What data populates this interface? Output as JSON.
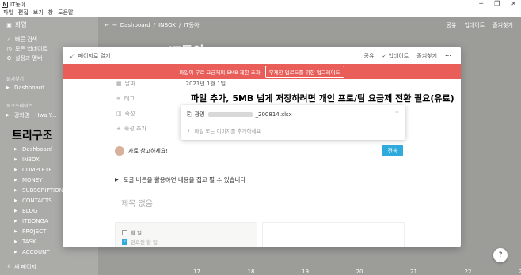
{
  "window": {
    "app_title": "IT동아",
    "menus": [
      "파일",
      "편집",
      "보기",
      "창",
      "도움말"
    ],
    "min_icon": "─",
    "max_icon": "❐",
    "close_icon": "✕"
  },
  "sidebar": {
    "workspace": "화영",
    "quick_items": [
      {
        "icon": "search-icon",
        "glyph": "⌕",
        "label": "빠른 검색"
      },
      {
        "icon": "clock-icon",
        "glyph": "◷",
        "label": "모든 업데이트"
      },
      {
        "icon": "gear-icon",
        "glyph": "⚙",
        "label": "설정과 멤버"
      }
    ],
    "favorites_header": "즐겨찾기",
    "favorites": [
      {
        "label": "Dashboard"
      }
    ],
    "workspace_header": "워크스페이스",
    "workspace_item": "강화영 - Hwa Y...",
    "overlay_title": "트리구조",
    "tree": [
      {
        "label": "Dashboard"
      },
      {
        "label": "INBOX"
      },
      {
        "label": "COMPLETE"
      },
      {
        "label": "MONEY"
      },
      {
        "label": "SUBSCRIPTION"
      },
      {
        "label": "CONTACTS"
      },
      {
        "label": "BLOG"
      },
      {
        "label": "ITDONGA"
      },
      {
        "label": "PROJECT"
      },
      {
        "label": "TASK"
      },
      {
        "label": "ACCOUNT"
      }
    ],
    "new_page": "새 페이지"
  },
  "main": {
    "breadcrumb": [
      "Dashboard",
      "INBOX",
      "IT동아"
    ],
    "topbar_actions": [
      "공유",
      "업데이트",
      "즐겨찾기"
    ],
    "bg_title": "IT동아",
    "calendar_numbers": [
      "17",
      "18",
      "19",
      "20",
      "21",
      "22",
      "23"
    ]
  },
  "modal": {
    "open_as_page": "페이지로 열기",
    "actions": [
      "공유",
      "업데이트",
      "즐겨찾기"
    ],
    "banner_text": "파일이 무료 요금제의 5MB 제한 초과",
    "banner_button": "무제한 업로드를 위한 업그레이드",
    "props": [
      {
        "label": "날짜",
        "value": "2021년 1월 1일"
      },
      {
        "label": "태그",
        "value": "비어 있음"
      },
      {
        "label": "속성",
        "value": ""
      },
      {
        "label": "속성 추가",
        "value": ""
      }
    ],
    "overlay_caption": "파일 추가, 5MB 넘게 저장하려면 개인 프로/팀 요금제 전환 필요(유료)",
    "file": {
      "prefix": "광명",
      "suffix": "_200814.xlsx",
      "more": "···",
      "add_label": "파일 또는 이미지를 추가하세요"
    },
    "comment": {
      "text": "자료 참고하세요!",
      "at": "@",
      "send": "전송"
    },
    "toggle_text": "토글 버튼을 활용하면 내용을 접고 펼 수 있습니다",
    "untitled": "제목 없음",
    "tasks": [
      {
        "label": "할 일",
        "done": false
      },
      {
        "label": "완료된 할 일",
        "done": true
      }
    ],
    "help": "?"
  }
}
